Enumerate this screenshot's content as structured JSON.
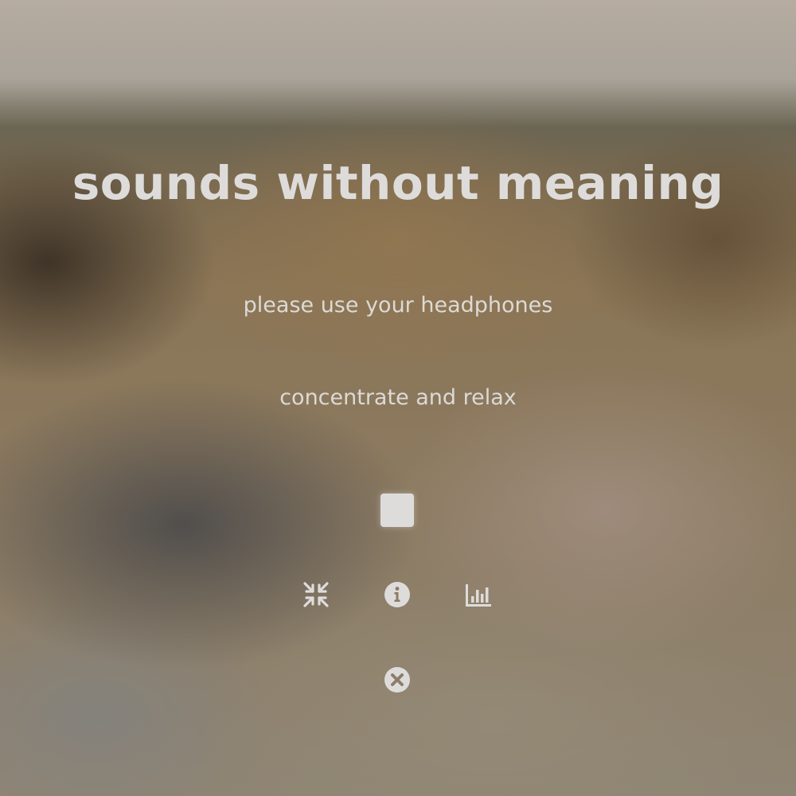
{
  "title": "sounds without meaning",
  "subtitles": [
    "please use your headphones",
    "concentrate and relax"
  ],
  "controls": {
    "play_stop": "stop-icon",
    "fullscreen_exit": "compress-icon",
    "info": "info-icon",
    "stats": "bar-chart-icon",
    "close": "close-icon"
  },
  "colors": {
    "foreground": "#dcdcdc"
  }
}
